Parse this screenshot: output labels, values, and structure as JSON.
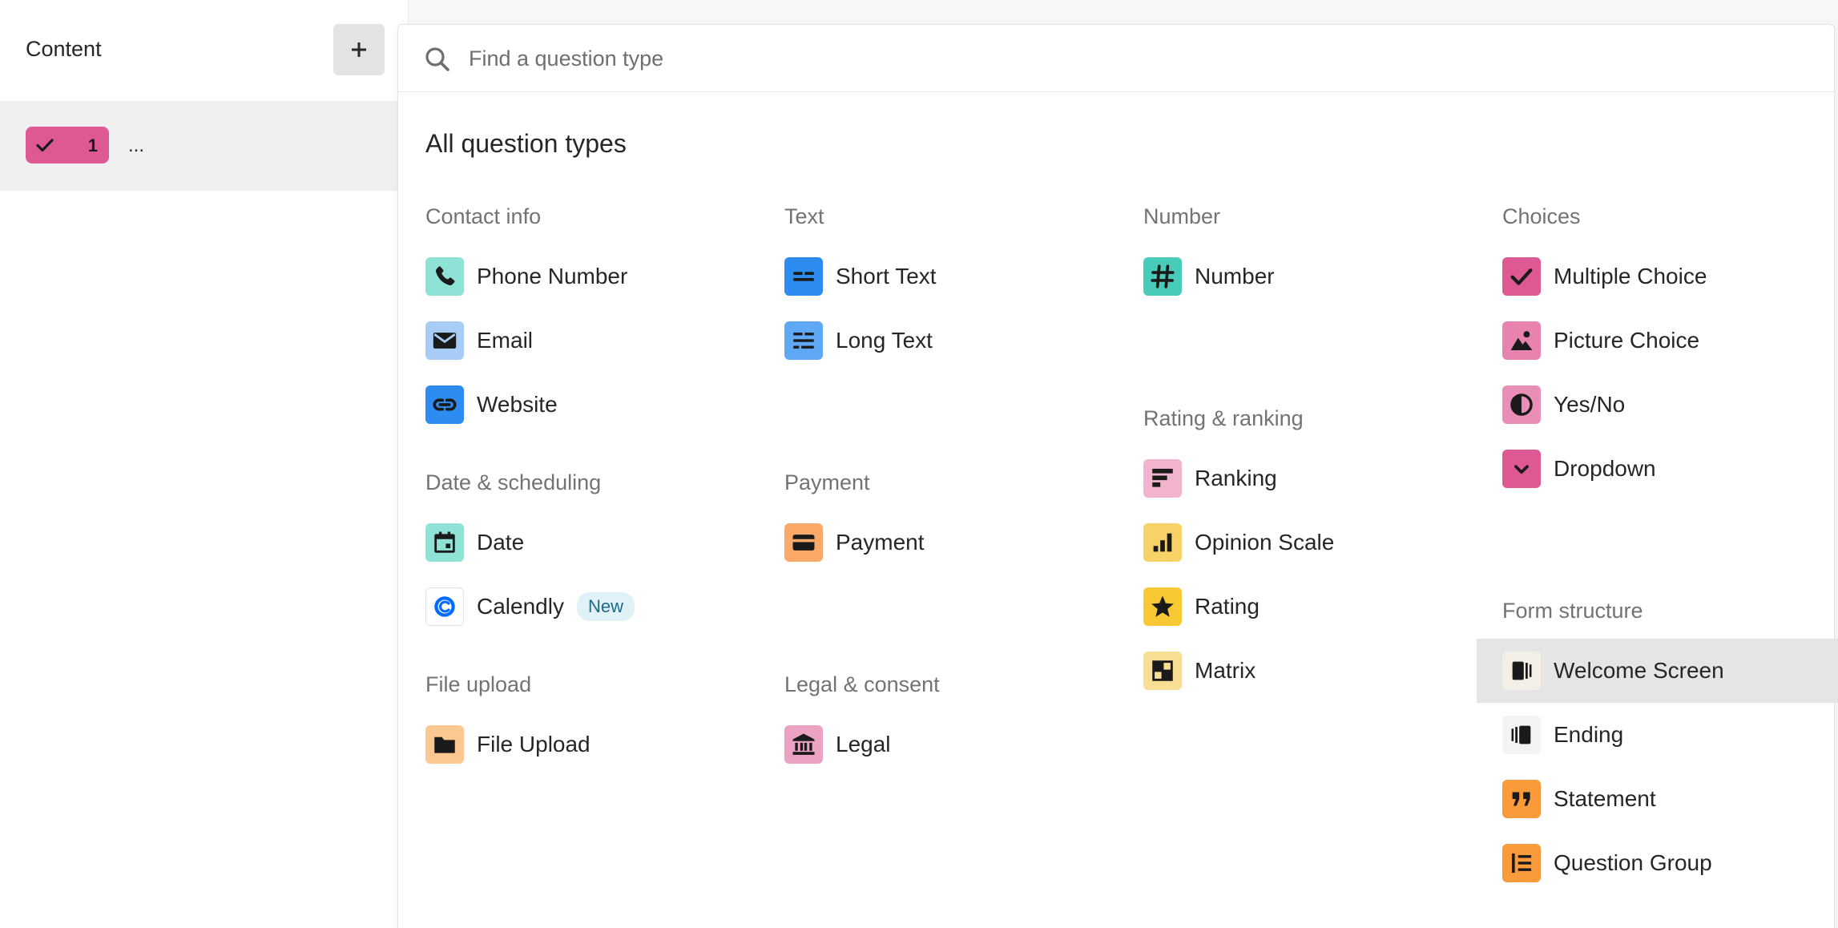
{
  "sidebar": {
    "title": "Content",
    "add_button_label": "+",
    "question": {
      "number": "1",
      "title": "..."
    }
  },
  "search": {
    "placeholder": "Find a question type",
    "value": ""
  },
  "heading": "All question types",
  "groups": {
    "contact_info": {
      "title": "Contact info",
      "items": [
        {
          "label": "Phone Number",
          "icon": "phone-icon",
          "color": "#8ee3d6"
        },
        {
          "label": "Email",
          "icon": "envelope-icon",
          "color": "#a7cdf7"
        },
        {
          "label": "Website",
          "icon": "link-icon",
          "color": "#2d8cf0"
        }
      ]
    },
    "date_scheduling": {
      "title": "Date & scheduling",
      "items": [
        {
          "label": "Date",
          "icon": "calendar-icon",
          "color": "#8ee3d6"
        },
        {
          "label": "Calendly",
          "icon": "calendly-logo-icon",
          "color": "#ffffff",
          "badge": "New"
        }
      ]
    },
    "file_upload": {
      "title": "File upload",
      "items": [
        {
          "label": "File Upload",
          "icon": "folder-icon",
          "color": "#fcc891"
        }
      ]
    },
    "text": {
      "title": "Text",
      "items": [
        {
          "label": "Short Text",
          "icon": "short-text-icon",
          "color": "#2d8cf0"
        },
        {
          "label": "Long Text",
          "icon": "long-text-icon",
          "color": "#5ea8f5"
        }
      ]
    },
    "payment": {
      "title": "Payment",
      "items": [
        {
          "label": "Payment",
          "icon": "credit-card-icon",
          "color": "#fba968"
        }
      ]
    },
    "legal_consent": {
      "title": "Legal & consent",
      "items": [
        {
          "label": "Legal",
          "icon": "courthouse-icon",
          "color": "#eca2c3"
        }
      ]
    },
    "number": {
      "title": "Number",
      "items": [
        {
          "label": "Number",
          "icon": "hash-icon",
          "color": "#48cbb9"
        }
      ]
    },
    "rating_ranking": {
      "title": "Rating & ranking",
      "items": [
        {
          "label": "Ranking",
          "icon": "ranking-icon",
          "color": "#f2b3cd"
        },
        {
          "label": "Opinion Scale",
          "icon": "bar-chart-icon",
          "color": "#f7d266"
        },
        {
          "label": "Rating",
          "icon": "star-icon",
          "color": "#f8c835"
        },
        {
          "label": "Matrix",
          "icon": "matrix-icon",
          "color": "#f9df93"
        }
      ]
    },
    "choices": {
      "title": "Choices",
      "items": [
        {
          "label": "Multiple Choice",
          "icon": "checkmark-icon",
          "color": "#de5894"
        },
        {
          "label": "Picture Choice",
          "icon": "image-icon",
          "color": "#e883b0"
        },
        {
          "label": "Yes/No",
          "icon": "half-circle-icon",
          "color": "#e98eb7"
        },
        {
          "label": "Dropdown",
          "icon": "chevron-down-icon",
          "color": "#de5894"
        }
      ]
    },
    "form_structure": {
      "title": "Form structure",
      "items": [
        {
          "label": "Welcome Screen",
          "icon": "welcome-screen-icon",
          "color": "#f3efe6"
        },
        {
          "label": "Ending",
          "icon": "ending-screen-icon",
          "color": "#f3f3f3"
        },
        {
          "label": "Statement",
          "icon": "quote-icon",
          "color": "#f99a3b"
        },
        {
          "label": "Question Group",
          "icon": "question-group-icon",
          "color": "#f99a3b"
        }
      ]
    }
  },
  "colors": {
    "accent_pink": "#de5894",
    "highlight_row": "#e5e5e5",
    "muted_text": "#737373",
    "new_badge_bg": "#e0f1f7"
  }
}
